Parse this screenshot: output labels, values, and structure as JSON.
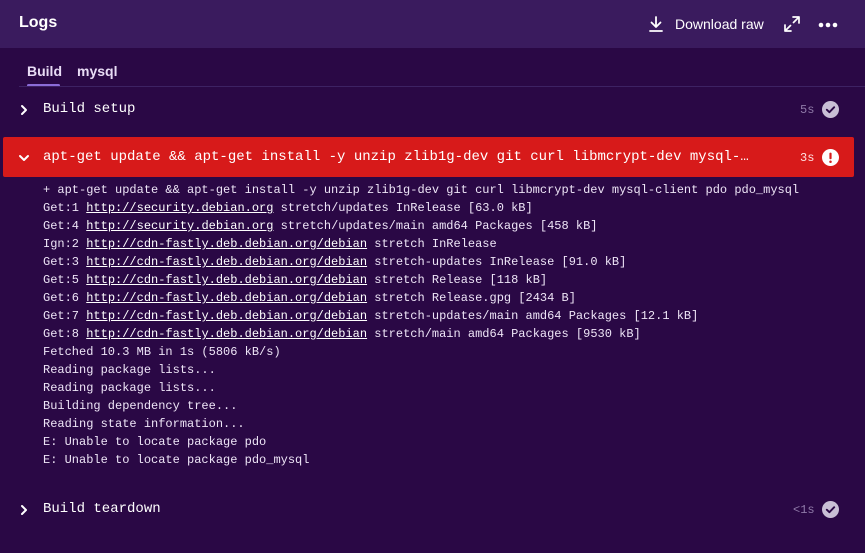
{
  "header": {
    "title": "Logs",
    "download_label": "Download raw",
    "download_icon": "download-icon",
    "expand_icon": "expand-icon",
    "more_icon": "more-icon"
  },
  "tabs": [
    {
      "label": "Build",
      "active": true
    },
    {
      "label": "mysql",
      "active": false
    }
  ],
  "steps": {
    "setup": {
      "name": "Build setup",
      "duration": "5s",
      "status": "success",
      "expanded": false
    },
    "failed": {
      "name": "apt-get update && apt-get install -y unzip zlib1g-dev git curl libmcrypt-dev mysql-client pdo pdo_mysql",
      "duration": "3s",
      "status": "error",
      "expanded": true
    },
    "teardown": {
      "name": "Build teardown",
      "duration": "<1s",
      "status": "success",
      "expanded": false
    }
  },
  "log": [
    {
      "prefix": "+ apt-get update && apt-get install -y unzip zlib1g-dev git curl libmcrypt-dev mysql-client pdo pdo_mysql",
      "link": "",
      "suffix": ""
    },
    {
      "prefix": "Get:1 ",
      "link": "http://security.debian.org",
      "suffix": " stretch/updates InRelease [63.0 kB]"
    },
    {
      "prefix": "Get:4 ",
      "link": "http://security.debian.org",
      "suffix": " stretch/updates/main amd64 Packages [458 kB]"
    },
    {
      "prefix": "Ign:2 ",
      "link": "http://cdn-fastly.deb.debian.org/debian",
      "suffix": " stretch InRelease"
    },
    {
      "prefix": "Get:3 ",
      "link": "http://cdn-fastly.deb.debian.org/debian",
      "suffix": " stretch-updates InRelease [91.0 kB]"
    },
    {
      "prefix": "Get:5 ",
      "link": "http://cdn-fastly.deb.debian.org/debian",
      "suffix": " stretch Release [118 kB]"
    },
    {
      "prefix": "Get:6 ",
      "link": "http://cdn-fastly.deb.debian.org/debian",
      "suffix": " stretch Release.gpg [2434 B]"
    },
    {
      "prefix": "Get:7 ",
      "link": "http://cdn-fastly.deb.debian.org/debian",
      "suffix": " stretch-updates/main amd64 Packages [12.1 kB]"
    },
    {
      "prefix": "Get:8 ",
      "link": "http://cdn-fastly.deb.debian.org/debian",
      "suffix": " stretch/main amd64 Packages [9530 kB]"
    },
    {
      "prefix": "Fetched 10.3 MB in 1s (5806 kB/s)",
      "link": "",
      "suffix": ""
    },
    {
      "prefix": "Reading package lists...",
      "link": "",
      "suffix": ""
    },
    {
      "prefix": "Reading package lists...",
      "link": "",
      "suffix": ""
    },
    {
      "prefix": "Building dependency tree...",
      "link": "",
      "suffix": ""
    },
    {
      "prefix": "Reading state information...",
      "link": "",
      "suffix": ""
    },
    {
      "prefix": "E: Unable to locate package pdo",
      "link": "",
      "suffix": ""
    },
    {
      "prefix": "E: Unable to locate package pdo_mysql",
      "link": "",
      "suffix": ""
    }
  ],
  "colors": {
    "background": "#2a0845",
    "header_bg": "#3a1b5e",
    "error": "#d71a1a",
    "accent": "#8c6cd8",
    "success_icon": "#c9bfd6"
  }
}
